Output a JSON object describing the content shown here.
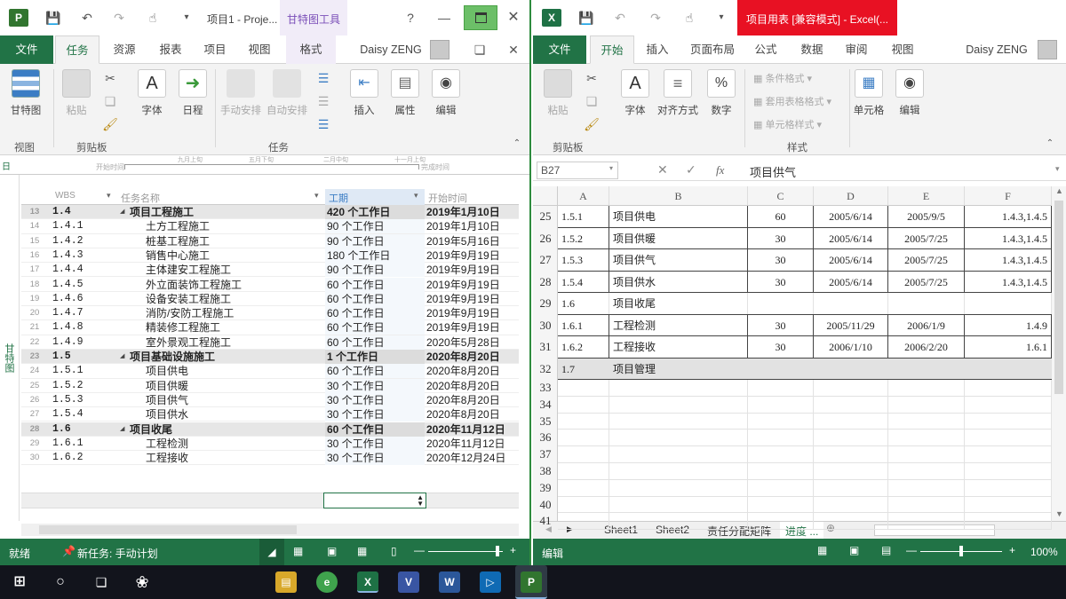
{
  "project": {
    "title": "项目1 - Proje...",
    "context_tab": "甘特图工具",
    "help": "?",
    "user": "Daisy ZENG",
    "tabs": [
      "文件",
      "任务",
      "资源",
      "报表",
      "项目",
      "视图",
      "格式"
    ],
    "ribbon": {
      "gantt_chart": "甘特图",
      "paste": "粘贴",
      "font": "字体",
      "schedule": "日程",
      "manual": "手动安排",
      "auto": "自动安排",
      "insert": "插入",
      "properties": "属性",
      "edit": "编辑",
      "group_view": "视图",
      "group_clipboard": "剪贴板",
      "group_tasks": "任务"
    },
    "timescale": {
      "start": "开始时间",
      "finish": "完成时间",
      "m1": "九月上旬",
      "m2": "五月下旬",
      "m3": "二月中旬",
      "m4": "十一月上旬"
    },
    "side_label": "甘特图",
    "columns": {
      "wbs": "WBS",
      "name": "任务名称",
      "duration": "工期",
      "start": "开始时间"
    },
    "rows": [
      {
        "id": "13",
        "wbs": "1.4",
        "name": "项目工程施工",
        "duration": "420 个工作日",
        "start": "2019年1月10日",
        "summary": true
      },
      {
        "id": "14",
        "wbs": "1.4.1",
        "name": "土方工程施工",
        "duration": "90 个工作日",
        "start": "2019年1月10日"
      },
      {
        "id": "15",
        "wbs": "1.4.2",
        "name": "桩基工程施工",
        "duration": "90 个工作日",
        "start": "2019年5月16日"
      },
      {
        "id": "16",
        "wbs": "1.4.3",
        "name": "销售中心施工",
        "duration": "180 个工作日",
        "start": "2019年9月19日"
      },
      {
        "id": "17",
        "wbs": "1.4.4",
        "name": "主体建安工程施工",
        "duration": "90 个工作日",
        "start": "2019年9月19日"
      },
      {
        "id": "18",
        "wbs": "1.4.5",
        "name": "外立面装饰工程施工",
        "duration": "60 个工作日",
        "start": "2019年9月19日"
      },
      {
        "id": "19",
        "wbs": "1.4.6",
        "name": "设备安装工程施工",
        "duration": "60 个工作日",
        "start": "2019年9月19日"
      },
      {
        "id": "20",
        "wbs": "1.4.7",
        "name": "消防/安防工程施工",
        "duration": "60 个工作日",
        "start": "2019年9月19日"
      },
      {
        "id": "21",
        "wbs": "1.4.8",
        "name": "精装修工程施工",
        "duration": "60 个工作日",
        "start": "2019年9月19日"
      },
      {
        "id": "22",
        "wbs": "1.4.9",
        "name": "室外景观工程施工",
        "duration": "60 个工作日",
        "start": "2020年5月28日"
      },
      {
        "id": "23",
        "wbs": "1.5",
        "name": "项目基础设施施工",
        "duration": "1 个工作日",
        "start": "2020年8月20日",
        "summary": true
      },
      {
        "id": "24",
        "wbs": "1.5.1",
        "name": "项目供电",
        "duration": "60 个工作日",
        "start": "2020年8月20日"
      },
      {
        "id": "25",
        "wbs": "1.5.2",
        "name": "项目供暖",
        "duration": "30 个工作日",
        "start": "2020年8月20日"
      },
      {
        "id": "26",
        "wbs": "1.5.3",
        "name": "项目供气",
        "duration": "30 个工作日",
        "start": "2020年8月20日"
      },
      {
        "id": "27",
        "wbs": "1.5.4",
        "name": "项目供水",
        "duration": "30 个工作日",
        "start": "2020年8月20日"
      },
      {
        "id": "28",
        "wbs": "1.6",
        "name": "项目收尾",
        "duration": "60 个工作日",
        "start": "2020年11月12日",
        "summary": true
      },
      {
        "id": "29",
        "wbs": "1.6.1",
        "name": "工程检测",
        "duration": "30 个工作日",
        "start": "2020年11月12日"
      },
      {
        "id": "30",
        "wbs": "1.6.2",
        "name": "工程接收",
        "duration": "30 个工作日",
        "start": "2020年12月24日"
      }
    ],
    "status": {
      "ready": "就绪",
      "new_task": "新任务: 手动计划"
    }
  },
  "excel": {
    "title": "项目用表 [兼容模式] - Excel(...",
    "user": "Daisy ZENG",
    "tabs": [
      "文件",
      "开始",
      "插入",
      "页面布局",
      "公式",
      "数据",
      "审阅",
      "视图"
    ],
    "ribbon": {
      "paste": "粘贴",
      "font": "字体",
      "align": "对齐方式",
      "number": "数字",
      "cond_format": "条件格式",
      "table_format": "套用表格格式",
      "cell_style": "单元格样式",
      "cells": "单元格",
      "edit": "编辑",
      "group_clipboard": "剪贴板",
      "group_style": "样式"
    },
    "name_box": "B27",
    "formula": "项目供气",
    "fx": "fx",
    "columns": [
      "A",
      "B",
      "C",
      "D",
      "E",
      "F"
    ],
    "rows": [
      {
        "n": "25",
        "a": "1.5.1",
        "b": "项目供电",
        "c": "60",
        "d": "2005/6/14",
        "e": "2005/9/5",
        "f": "1.4.3,1.4.5"
      },
      {
        "n": "26",
        "a": "1.5.2",
        "b": "项目供暖",
        "c": "30",
        "d": "2005/6/14",
        "e": "2005/7/25",
        "f": "1.4.3,1.4.5"
      },
      {
        "n": "27",
        "a": "1.5.3",
        "b": "项目供气",
        "c": "30",
        "d": "2005/6/14",
        "e": "2005/7/25",
        "f": "1.4.3,1.4.5"
      },
      {
        "n": "28",
        "a": "1.5.4",
        "b": "项目供水",
        "c": "30",
        "d": "2005/6/14",
        "e": "2005/7/25",
        "f": "1.4.3,1.4.5"
      },
      {
        "n": "29",
        "a": "1.6",
        "b": "项目收尾",
        "c": "",
        "d": "",
        "e": "",
        "f": ""
      },
      {
        "n": "30",
        "a": "1.6.1",
        "b": "工程检测",
        "c": "30",
        "d": "2005/11/29",
        "e": "2006/1/9",
        "f": "1.4.9"
      },
      {
        "n": "31",
        "a": "1.6.2",
        "b": "工程接收",
        "c": "30",
        "d": "2006/1/10",
        "e": "2006/2/20",
        "f": "1.6.1"
      },
      {
        "n": "32",
        "a": "1.7",
        "b": "项目管理",
        "c": "",
        "d": "",
        "e": "",
        "f": ""
      }
    ],
    "empty_rows": [
      "33",
      "34",
      "35",
      "36",
      "37",
      "38",
      "39",
      "40",
      "41"
    ],
    "sheets": [
      "Sheet1",
      "Sheet2",
      "责任分配矩阵",
      "进度 ..."
    ],
    "status": {
      "edit": "编辑",
      "zoom": "100%"
    }
  },
  "colors": {
    "project_green": "#217346",
    "excel_red": "#e81123",
    "gantt_purple": "#7b4fb8",
    "taskbar": "#12141c"
  }
}
